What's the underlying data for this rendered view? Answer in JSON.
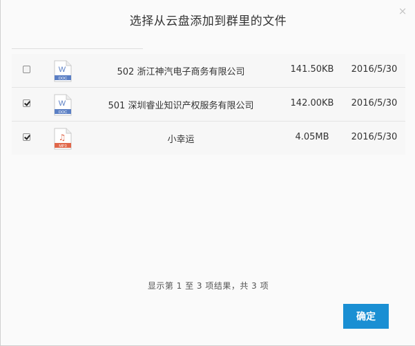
{
  "dialog": {
    "title": "选择从云盘添加到群里的文件",
    "close_glyph": "×"
  },
  "files": [
    {
      "checked": false,
      "type": "DOC",
      "icon": "word-doc-icon",
      "icon_glyph": "W",
      "accent": "#5b7fc4",
      "name": "502 浙江神汽电子商务有限公司",
      "size": "141.50KB",
      "date": "2016/5/30"
    },
    {
      "checked": true,
      "type": "DOC",
      "icon": "word-doc-icon",
      "icon_glyph": "W",
      "accent": "#5b7fc4",
      "name": "501 深圳睿业知识产权服务有限公司",
      "size": "142.00KB",
      "date": "2016/5/30"
    },
    {
      "checked": true,
      "type": "MP3",
      "icon": "mp3-audio-icon",
      "icon_glyph": "♫",
      "accent": "#e0674a",
      "name": "小幸运",
      "size": "4.05MB",
      "date": "2016/5/30"
    }
  ],
  "pager": {
    "summary": "显示第 1 至 3 项结果，共 3 项"
  },
  "actions": {
    "confirm_label": "确定"
  },
  "colors": {
    "primary": "#1a8fd3"
  }
}
